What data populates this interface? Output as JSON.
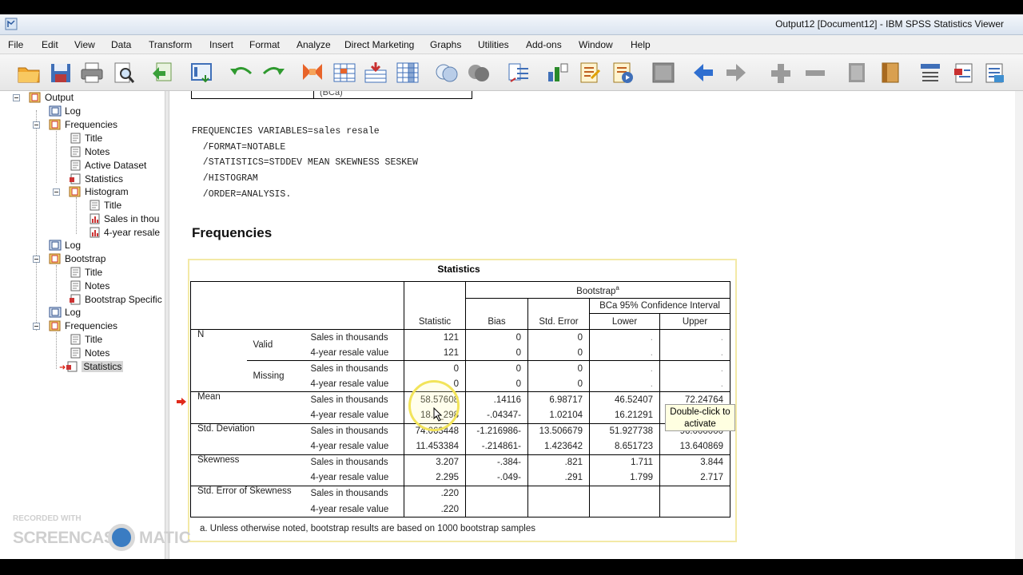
{
  "window": {
    "title": "Output12 [Document12] - IBM SPSS Statistics Viewer"
  },
  "menu": [
    "File",
    "Edit",
    "View",
    "Data",
    "Transform",
    "Insert",
    "Format",
    "Analyze",
    "Direct Marketing",
    "Graphs",
    "Utilities",
    "Add-ons",
    "Window",
    "Help"
  ],
  "toolbar_icons": [
    "open-icon",
    "save-icon",
    "print-icon",
    "print-preview-icon",
    "export-icon",
    "recall-dialog-icon",
    "undo-icon",
    "redo-icon",
    "goto-data-icon",
    "goto-case-icon",
    "goto-variable-icon",
    "variables-icon",
    "use-sets-icon",
    "show-all-icon",
    "split-file-icon",
    "weight-icon",
    "select-cases-icon",
    "value-labels-icon",
    "designate-window-icon",
    "promote-icon",
    "demote-icon",
    "expand-icon",
    "collapse-icon",
    "show-icon",
    "hide-icon",
    "insert-heading-icon",
    "insert-title-icon",
    "insert-text-icon"
  ],
  "tree": {
    "items": [
      {
        "label": "Output",
        "type": "book"
      },
      {
        "label": "Log",
        "type": "log"
      },
      {
        "label": "Frequencies",
        "type": "book"
      },
      {
        "label": "Title",
        "type": "page"
      },
      {
        "label": "Notes",
        "type": "page"
      },
      {
        "label": "Active Dataset",
        "type": "page"
      },
      {
        "label": "Statistics",
        "type": "table"
      },
      {
        "label": "Histogram",
        "type": "book"
      },
      {
        "label": "Title",
        "type": "page"
      },
      {
        "label": "Sales in thou",
        "type": "chart"
      },
      {
        "label": "4-year resale",
        "type": "chart"
      },
      {
        "label": "Log",
        "type": "log"
      },
      {
        "label": "Bootstrap",
        "type": "book"
      },
      {
        "label": "Title",
        "type": "page"
      },
      {
        "label": "Notes",
        "type": "page"
      },
      {
        "label": "Bootstrap Specific",
        "type": "table"
      },
      {
        "label": "Log",
        "type": "log"
      },
      {
        "label": "Frequencies",
        "type": "book"
      },
      {
        "label": "Title",
        "type": "page"
      },
      {
        "label": "Notes",
        "type": "page"
      },
      {
        "label": "Statistics",
        "type": "table"
      }
    ]
  },
  "content": {
    "prev_table_cell": "(BCa)",
    "syntax": [
      "FREQUENCIES VARIABLES=sales resale",
      "  /FORMAT=NOTABLE",
      "  /STATISTICS=STDDEV MEAN SKEWNESS SESKEW",
      "  /HISTOGRAM",
      "  /ORDER=ANALYSIS."
    ],
    "heading": "Frequencies",
    "table_title": "Statistics",
    "headers": {
      "bootstrap": "Bootstrap",
      "bootstrap_sup": "a",
      "statistic": "Statistic",
      "bias": "Bias",
      "std_error": "Std. Error",
      "ci": "BCa 95% Confidence Interval",
      "lower": "Lower",
      "upper": "Upper"
    },
    "rows": [
      {
        "g1": "N",
        "g2": "Valid",
        "var": "Sales in thousands",
        "stat": "121",
        "bias": "0",
        "se": "0",
        "lower": ".",
        "upper": "."
      },
      {
        "g1": "",
        "g2": "",
        "var": "4-year resale value",
        "stat": "121",
        "bias": "0",
        "se": "0",
        "lower": ".",
        "upper": "."
      },
      {
        "g1": "",
        "g2": "Missing",
        "var": "Sales in thousands",
        "stat": "0",
        "bias": "0",
        "se": "0",
        "lower": ".",
        "upper": "."
      },
      {
        "g1": "",
        "g2": "",
        "var": "4-year resale value",
        "stat": "0",
        "bias": "0",
        "se": "0",
        "lower": ".",
        "upper": "."
      },
      {
        "g1": "Mean",
        "g2": "",
        "var": "Sales in thousands",
        "stat": "58.57608",
        "bias": ".14116",
        "se": "6.98717",
        "lower": "46.52407",
        "upper": "72.24764"
      },
      {
        "g1": "",
        "g2": "",
        "var": "4-year resale value",
        "stat": "18.0_298",
        "bias": "-.04347-",
        "se": "1.02104",
        "lower": "16.21291",
        "upper": ""
      },
      {
        "g1": "Std. Deviation",
        "g2": "",
        "var": "Sales in thousands",
        "stat": "74.063448",
        "bias": "-1.216986-",
        "se": "13.506679",
        "lower": "51.927738",
        "upper": "96.000000"
      },
      {
        "g1": "",
        "g2": "",
        "var": "4-year resale value",
        "stat": "11.453384",
        "bias": "-.214861-",
        "se": "1.423642",
        "lower": "8.651723",
        "upper": "13.640869"
      },
      {
        "g1": "Skewness",
        "g2": "",
        "var": "Sales in thousands",
        "stat": "3.207",
        "bias": "-.384-",
        "se": ".821",
        "lower": "1.711",
        "upper": "3.844"
      },
      {
        "g1": "",
        "g2": "",
        "var": "4-year resale value",
        "stat": "2.295",
        "bias": "-.049-",
        "se": ".291",
        "lower": "1.799",
        "upper": "2.717"
      },
      {
        "g1": "Std. Error of Skewness",
        "g2": "",
        "var": "Sales in thousands",
        "stat": ".220",
        "bias": "",
        "se": "",
        "lower": "",
        "upper": ""
      },
      {
        "g1": "",
        "g2": "",
        "var": "4-year resale value",
        "stat": ".220",
        "bias": "",
        "se": "",
        "lower": "",
        "upper": ""
      }
    ],
    "footnote": "a. Unless otherwise noted, bootstrap results are based on 1000 bootstrap samples",
    "tooltip": [
      "Double-click to",
      "activate"
    ]
  },
  "watermark": {
    "line1": "RECORDED WITH",
    "line2a": "SCREENCAST",
    "line2b": "MATIC"
  }
}
